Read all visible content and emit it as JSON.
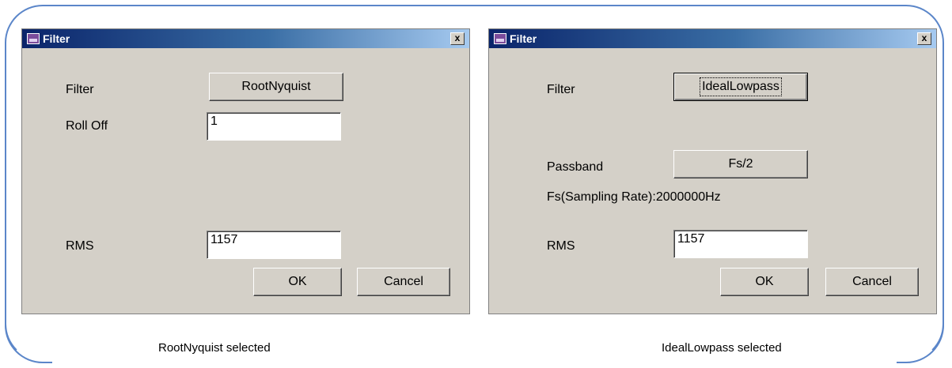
{
  "left_dialog": {
    "title": "Filter",
    "close_glyph": "x",
    "filter_label": "Filter",
    "filter_button": "RootNyquist",
    "rolloff_label": "Roll Off",
    "rolloff_value": "1",
    "rms_label": "RMS",
    "rms_value": "1157",
    "ok_label": "OK",
    "cancel_label": "Cancel"
  },
  "right_dialog": {
    "title": "Filter",
    "close_glyph": "x",
    "filter_label": "Filter",
    "filter_button": "IdealLowpass",
    "passband_label": "Passband",
    "passband_button": "Fs/2",
    "sampling_rate_text": "Fs(Sampling Rate):2000000Hz",
    "rms_label": "RMS",
    "rms_value": "1157",
    "ok_label": "OK",
    "cancel_label": "Cancel"
  },
  "captions": {
    "left": "RootNyquist selected",
    "right": "IdealLowpass selected"
  },
  "colors": {
    "frame_border": "#5b86c9",
    "dialog_bg": "#d4d0c8",
    "titlebar_start": "#0a246a",
    "titlebar_end": "#a6caf0"
  },
  "icons": [
    "app-icon",
    "close-icon"
  ]
}
